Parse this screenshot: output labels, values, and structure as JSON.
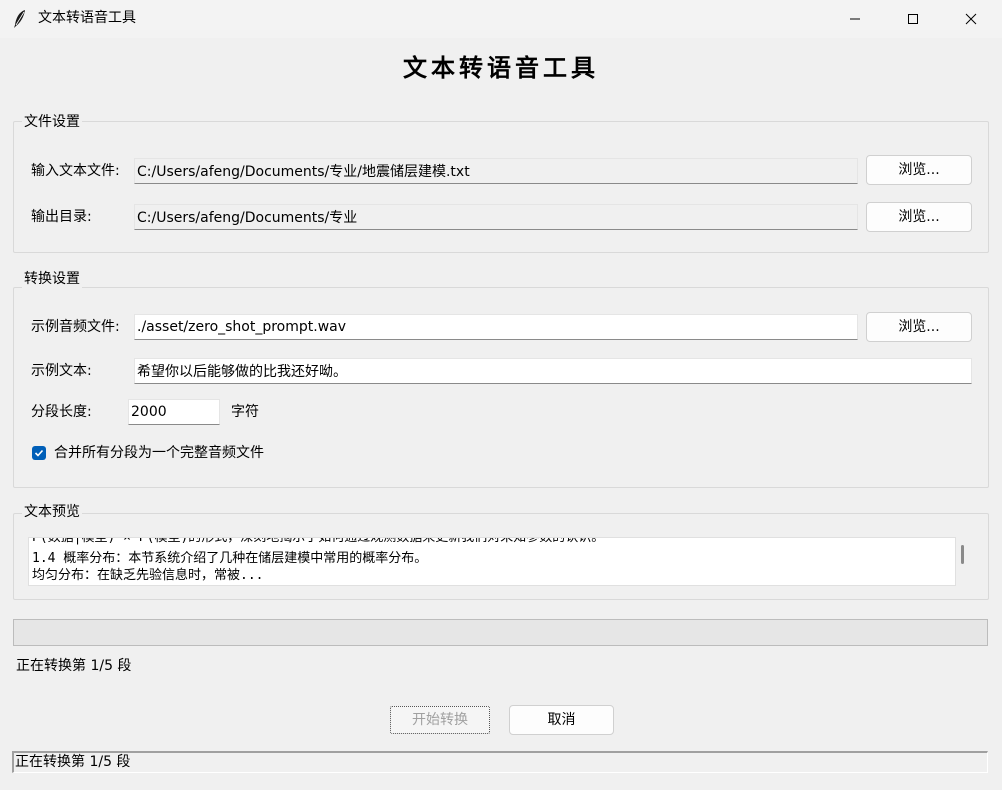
{
  "window": {
    "title": "文本转语音工具",
    "icon": "feather-icon"
  },
  "heading": "文本转语音工具",
  "file_settings": {
    "group_label": "文件设置",
    "input_label": "输入文本文件:",
    "input_value": "C:/Users/afeng/Documents/专业/地震储层建模.txt",
    "output_label": "输出目录:",
    "output_value": "C:/Users/afeng/Documents/专业",
    "browse_label": "浏览..."
  },
  "convert_settings": {
    "group_label": "转换设置",
    "audio_label": "示例音频文件:",
    "audio_value": "./asset/zero_shot_prompt.wav",
    "browse_label": "浏览...",
    "text_label": "示例文本:",
    "text_value": "希望你以后能够做的比我还好呦。",
    "segment_label": "分段长度:",
    "segment_value": "2000",
    "segment_unit": "字符",
    "merge_label": "合并所有分段为一个完整音频文件",
    "merge_checked": true
  },
  "preview": {
    "group_label": "文本预览",
    "lines": [
      "P(数据|模型) × P(模型)的形式，深刻地揭示了如何通过观测数据来更新我们对未知参数的认识。",
      "1.4 概率分布：本节系统介绍了几种在储层建模中常用的概率分布。",
      "均匀分布：在缺乏先验信息时，常被..."
    ]
  },
  "progress": {
    "value": 0
  },
  "status_text": "正在转换第 1/5 段",
  "buttons": {
    "start": "开始转换",
    "cancel": "取消"
  },
  "statusbar_text": "正在转换第 1/5 段"
}
